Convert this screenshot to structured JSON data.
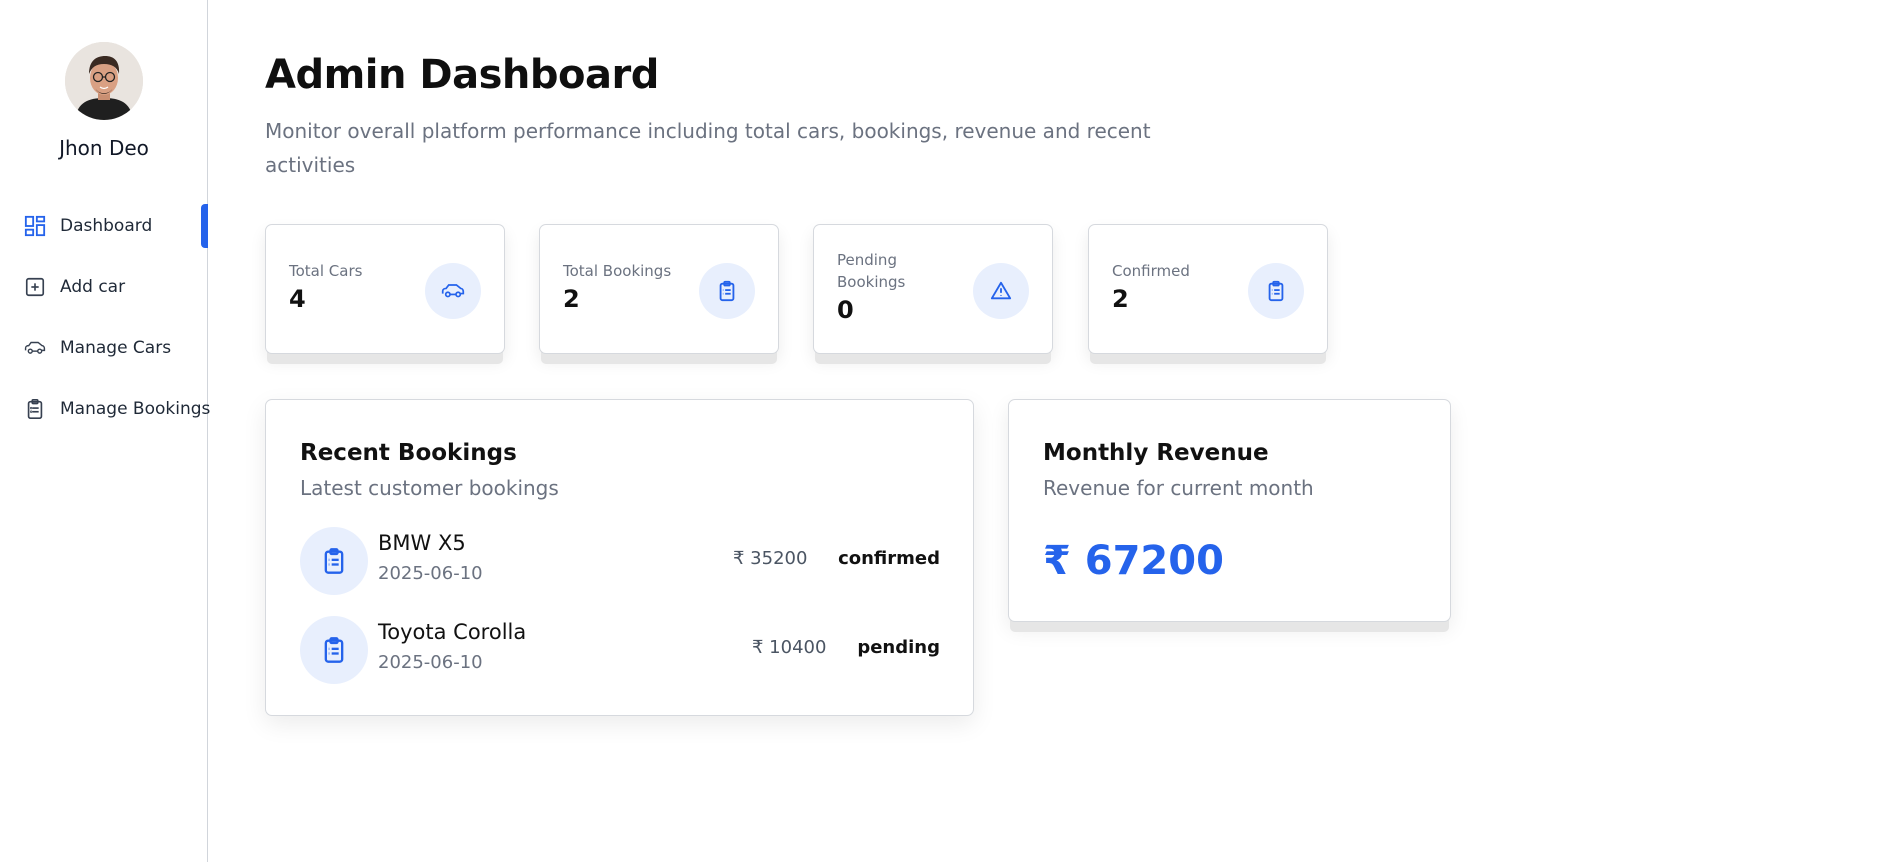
{
  "sidebar": {
    "user_name": "Jhon Deo",
    "items": [
      {
        "label": "Dashboard",
        "icon": "dashboard-icon",
        "active": true
      },
      {
        "label": "Add car",
        "icon": "plus-square-icon",
        "active": false
      },
      {
        "label": "Manage Cars",
        "icon": "car-icon",
        "active": false
      },
      {
        "label": "Manage Bookings",
        "icon": "clipboard-icon",
        "active": false
      }
    ]
  },
  "header": {
    "title": "Admin Dashboard",
    "subtitle": "Monitor overall platform performance including total cars, bookings, revenue and recent activities"
  },
  "stats": [
    {
      "label": "Total Cars",
      "value": "4",
      "icon": "car-icon"
    },
    {
      "label": "Total Bookings",
      "value": "2",
      "icon": "clipboard-icon"
    },
    {
      "label": "Pending Bookings",
      "value": "0",
      "icon": "warning-icon"
    },
    {
      "label": "Confirmed",
      "value": "2",
      "icon": "clipboard-icon"
    }
  ],
  "recent_bookings": {
    "title": "Recent Bookings",
    "subtitle": "Latest customer bookings",
    "rows": [
      {
        "car": "BMW X5",
        "date": "2025-06-10",
        "price": "₹ 35200",
        "status": "confirmed"
      },
      {
        "car": "Toyota Corolla",
        "date": "2025-06-10",
        "price": "₹ 10400",
        "status": "pending"
      }
    ]
  },
  "monthly_revenue": {
    "title": "Monthly Revenue",
    "subtitle": "Revenue for current month",
    "value": "₹ 67200"
  },
  "colors": {
    "accent": "#2563eb",
    "icon_bg": "#e8effd",
    "muted_text": "#6b7280",
    "border": "#d6d9de"
  }
}
